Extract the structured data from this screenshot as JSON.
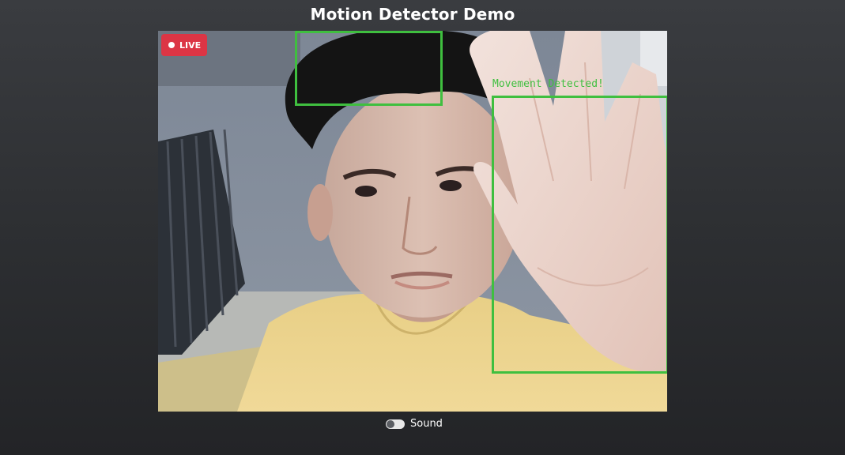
{
  "page": {
    "title": "Motion Detector Demo"
  },
  "video": {
    "live_badge": "LIVE",
    "detection_label": "Movement Detected!",
    "box_color": "#3fbf3f",
    "badge_color": "#dc3545"
  },
  "controls": {
    "sound_label": "Sound",
    "sound_enabled": false
  },
  "icons": {
    "live_indicator": "record-dot-icon",
    "sound_toggle": "toggle-switch-icon"
  }
}
